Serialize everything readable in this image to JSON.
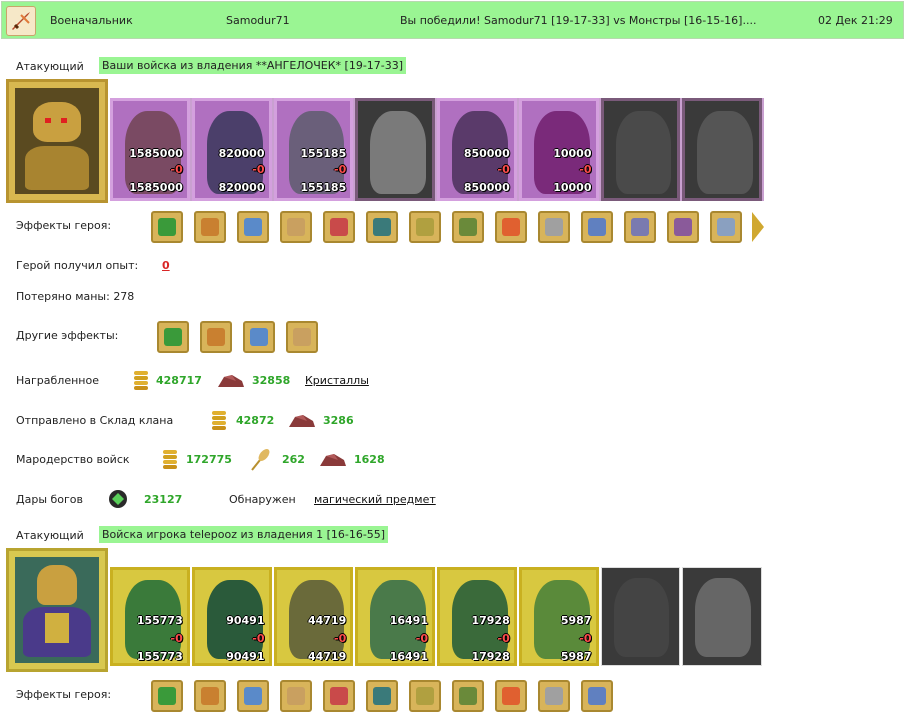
{
  "header": {
    "rank": "Военачальник",
    "user": "Samodur71",
    "message": "Вы победили! Samodur71 [19-17-33] vs Монстры [16-15-16]....",
    "date": "02 Дек 21:29"
  },
  "side1": {
    "role": "Атакующий",
    "title": "Ваши войска из владения **АНГЕЛОЧЕК* [19-17-33]",
    "units": [
      {
        "top": "1585000",
        "mid": "-0",
        "bot": "1585000",
        "color": "#7a4a63"
      },
      {
        "top": "820000",
        "mid": "-0",
        "bot": "820000",
        "color": "#4b3f6a"
      },
      {
        "top": "155185",
        "mid": "-0",
        "bot": "155185",
        "color": "#6a5f7a"
      },
      {
        "top": "",
        "mid": "",
        "bot": "",
        "color": "#7a7a7a"
      },
      {
        "top": "850000",
        "mid": "-0",
        "bot": "850000",
        "color": "#5a3a6a"
      },
      {
        "top": "10000",
        "mid": "-0",
        "bot": "10000",
        "color": "#7a2a7a"
      },
      {
        "top": "",
        "mid": "",
        "bot": "",
        "color": "#4a4a4a"
      },
      {
        "top": "",
        "mid": "",
        "bot": "",
        "color": "#555555"
      }
    ],
    "effects_label": "Эффекты героя:",
    "effects": [
      "sword-icon",
      "handshake-icon",
      "hand-icon",
      "tower-icon",
      "dice-icon",
      "shield-icon",
      "shake-shield-icon",
      "cauldron-icon",
      "fire-icon",
      "skull-icon",
      "claw-icon",
      "amulet-icon",
      "spider-icon",
      "question-icon"
    ],
    "exp_label": "Герой получил опыт:",
    "exp_value": "0",
    "mana_label": "Потеряно маны: 278",
    "other_label": "Другие эффекты:",
    "other_effects": [
      "gold-icon",
      "sword-icon",
      "sword-red-icon",
      "sword-red2-icon"
    ],
    "loot_label": "Награбленное",
    "loot_gold": "428717",
    "loot_ore": "32858",
    "loot_link": "Кристаллы",
    "clan_label": "Отправлено в Склад клана",
    "clan_gold": "42872",
    "clan_ore": "3286",
    "marauding_label": "Мародерство войск",
    "mar_gold": "172775",
    "mar_wheat": "262",
    "mar_ore": "1628",
    "gods_label": "Дары богов",
    "gods_value": "23127",
    "found_label": "Обнаружен",
    "found_link": "магический предмет"
  },
  "side2": {
    "role": "Атакующий",
    "title": "Войска игрока telepooz из владения 1 [16-16-55]",
    "units": [
      {
        "top": "155773",
        "mid": "-0",
        "bot": "155773",
        "color": "#3a7a3a"
      },
      {
        "top": "90491",
        "mid": "-0",
        "bot": "90491",
        "color": "#2a5a3a"
      },
      {
        "top": "44719",
        "mid": "-0",
        "bot": "44719",
        "color": "#6a6a3a"
      },
      {
        "top": "16491",
        "mid": "-0",
        "bot": "16491",
        "color": "#4a7a4a"
      },
      {
        "top": "17928",
        "mid": "-0",
        "bot": "17928",
        "color": "#3a6a3a"
      },
      {
        "top": "5987",
        "mid": "-0",
        "bot": "5987",
        "color": "#5a8a3a"
      },
      {
        "top": "",
        "mid": "",
        "bot": "",
        "color": "#444444"
      },
      {
        "top": "",
        "mid": "",
        "bot": "",
        "color": "#666666"
      }
    ],
    "effects_label": "Эффекты героя:",
    "effects": [
      "tower-icon",
      "dice-icon",
      "shield-icon",
      "amulet-icon",
      "scroll-icon",
      "ring-icon",
      "bird-icon",
      "serpent-icon",
      "sun-icon",
      "beast-icon",
      "flag-icon"
    ]
  }
}
